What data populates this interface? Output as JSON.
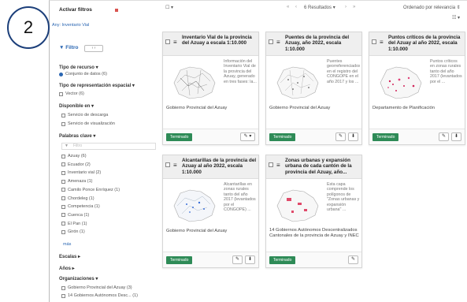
{
  "annotation": {
    "number": "2"
  },
  "sidebar": {
    "active_filters_title": "Activar filtros",
    "any_link": "Any: Inventario Vial",
    "filter_title": "Filtro",
    "pager_label": "‹  ›",
    "resource_type_title": "Tipo de recurso",
    "resource_type_items": [
      "Conjunto de datos (6)"
    ],
    "spatial_rep_title": "Tipo de representación espacial",
    "spatial_rep_items": [
      "Vector (6)"
    ],
    "available_title": "Disponible en",
    "available_items": [
      "Servicio de descarga",
      "Servicio de visualización"
    ],
    "keywords_title": "Palabras clave",
    "keywords_filter_placeholder": "Filtro",
    "keywords_items": [
      "Azuay (6)",
      "Ecuador (2)",
      "Inventario vial (2)",
      "Amenaza (1)",
      "Camilo Ponce Enríquez (1)",
      "Chordeleg (1)",
      "Competencia (1)",
      "Cuenca (1)",
      "El Pan (1)",
      "Girón (1)"
    ],
    "more_link": "más",
    "scales_title": "Escalas",
    "years_title": "Años",
    "orgs_title": "Organizaciones",
    "orgs_items": [
      "Gobierno Provincial del Azuay (3)",
      "14 Gobiernos Autónomos Desc... (1)"
    ]
  },
  "topbar": {
    "select_label": "☐ ▾",
    "nav_first": "«",
    "nav_prev": "‹",
    "results": "6 Resultados ▾",
    "nav_next": "›",
    "nav_last": "»",
    "sort": "Ordenado por relevancia ⇕",
    "view": "☷ ▾"
  },
  "cards": [
    {
      "title": "Inventario Vial de la provincia del Azuay a escala 1:10.000",
      "description": "Información del Inventario Vial de la provincia del Azuay, generado en tres fases: la...",
      "org": "Gobierno Provincial del Azuay",
      "status": "Terminado",
      "actions": [
        "✎ ▾"
      ]
    },
    {
      "title": "Puentes de la provincia del Azuay, año 2022, escala 1:10.000",
      "description": "Puentes georreferenciados en el registro del CONGOPE en el año 2017 y los ...",
      "org": "Gobierno Provincial del Azuay",
      "status": "Terminado",
      "actions": [
        "✎",
        "⬇"
      ]
    },
    {
      "title": "Puntos críticos de la provincia del Azuay al año 2022, escala 1:10.000",
      "description": "Puntos críticos en zonas rurales tanto del año 2017 (levantados por el ...",
      "org": "Departamento de Planificación",
      "status": "Terminado",
      "actions": [
        "✎",
        "⬇"
      ]
    },
    {
      "title": "Alcantarillas de la provincia del Azuay al año 2022, escala 1:10.000",
      "description": "Alcantarillas en zonas rurales tanto del año 2017 (levantados por el CONGOPE) ...",
      "org": "Gobierno Provincial del Azuay",
      "status": "Terminado",
      "actions": [
        "✎",
        "⬇"
      ]
    },
    {
      "title": "Zonas urbanas y expansión urbana de cada cantón de la provincia del Azuay, año...",
      "description": "Esta capa comprende los polígonos de \"Zonas urbanas y expansión urbana\" ...",
      "org": "14 Gobiernos Autónomos Descentralizados Cantonales de la provincia de Azuay y INEC",
      "status": "Terminado",
      "actions": [
        "✎"
      ]
    }
  ],
  "colors": {
    "status_green": "#2e8b57",
    "link_blue": "#2a66b2",
    "annotation_circle": "#1c3f7a",
    "active_filter_marker": "#d9534f"
  }
}
